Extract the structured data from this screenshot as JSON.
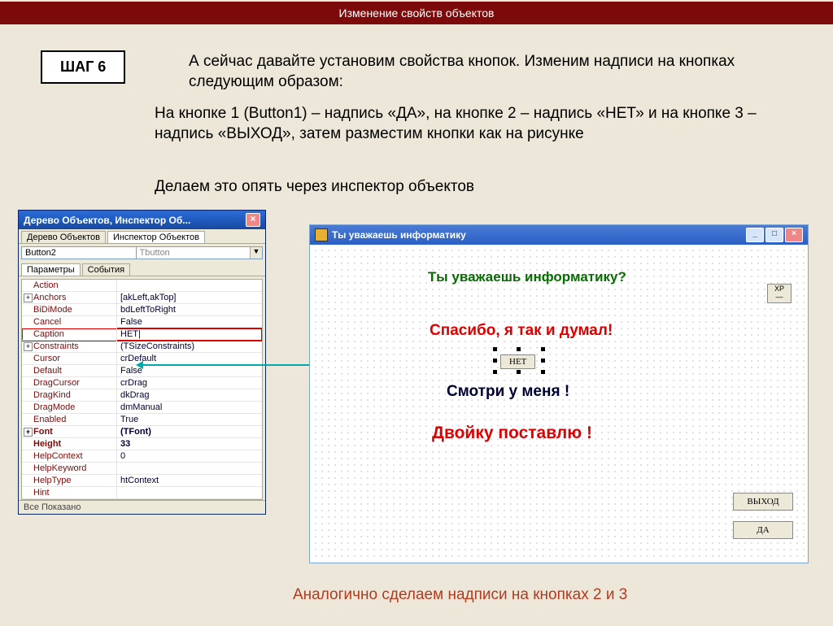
{
  "header_title": "Изменение свойств объектов",
  "step_label": "ШАГ 6",
  "para1": "А сейчас давайте установим свойства кнопок.  Изменим надписи на кнопках следующим образом:",
  "para2": "На кнопке 1 (Button1) – надпись «ДА», на кнопке 2 – надпись «НЕТ» и на кнопке 3 – надпись «ВЫХОД», затем разместим кнопки как на рисунке",
  "para3": "Делаем это опять через инспектор объектов",
  "footer_text": "Аналогично сделаем надписи на кнопках 2 и 3",
  "inspector": {
    "window_title": "Дерево Объектов, Инспектор Об...",
    "tab_tree": "Дерево Объектов",
    "tab_insp": "Инспектор Объектов",
    "obj_name": "Button2",
    "obj_class": "Tbutton",
    "tab_params": "Параметры",
    "tab_events": "События",
    "all_shown": "Все Показано",
    "props": [
      {
        "n": "Action",
        "v": "",
        "exp": ""
      },
      {
        "n": "Anchors",
        "v": "[akLeft,akTop]",
        "exp": "+"
      },
      {
        "n": "BiDiMode",
        "v": "bdLeftToRight",
        "exp": ""
      },
      {
        "n": "Cancel",
        "v": "False",
        "exp": ""
      },
      {
        "n": "Caption",
        "v": "НЕТ|",
        "exp": "",
        "hl": true
      },
      {
        "n": "Constraints",
        "v": "(TSizeConstraints)",
        "exp": "+"
      },
      {
        "n": "Cursor",
        "v": "crDefault",
        "exp": ""
      },
      {
        "n": "Default",
        "v": "False",
        "exp": ""
      },
      {
        "n": "DragCursor",
        "v": "crDrag",
        "exp": ""
      },
      {
        "n": "DragKind",
        "v": "dkDrag",
        "exp": ""
      },
      {
        "n": "DragMode",
        "v": "dmManual",
        "exp": ""
      },
      {
        "n": "Enabled",
        "v": "True",
        "exp": ""
      },
      {
        "n": "Font",
        "v": "(TFont)",
        "exp": "+",
        "bold": true
      },
      {
        "n": "Height",
        "v": "33",
        "exp": "",
        "bold": true
      },
      {
        "n": "HelpContext",
        "v": "0",
        "exp": ""
      },
      {
        "n": "HelpKeyword",
        "v": "",
        "exp": ""
      },
      {
        "n": "HelpType",
        "v": "htContext",
        "exp": ""
      },
      {
        "n": "Hint",
        "v": "",
        "exp": ""
      }
    ]
  },
  "designer": {
    "title": "Ты уважаешь информатику",
    "question": "Ты уважаешь информатику?",
    "thanks": "Спасибо, я так и думал!",
    "look": "Смотри у меня !",
    "two": "Двойку поставлю !",
    "btn_net": "НЕТ",
    "btn_exit": "ВЫХОД",
    "btn_da": "ДА",
    "xp": "XP"
  }
}
